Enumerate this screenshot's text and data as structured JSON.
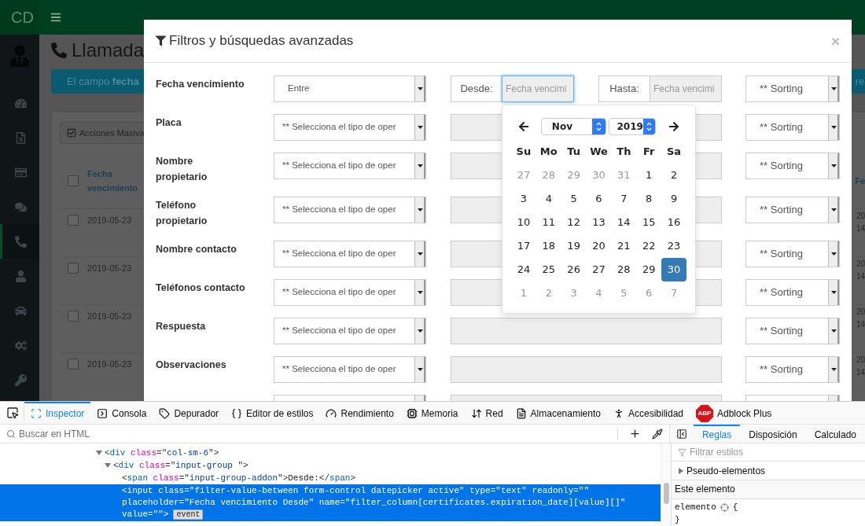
{
  "app": {
    "brand": "CD",
    "page_title": "Llamada",
    "sidebar_items": [
      {
        "selected": false
      },
      {
        "selected": false
      },
      {
        "selected": false
      },
      {
        "selected": false
      },
      {
        "selected": true
      },
      {
        "selected": false
      },
      {
        "selected": false
      },
      {
        "selected": false
      },
      {
        "selected": false
      }
    ],
    "notice": {
      "text": "El campo **fecha**",
      "tail": "re"
    },
    "bulk_button": "Acciones Masiva",
    "table": {
      "header": {
        "checked": false,
        "column_1": "Fecha vencimiento",
        "column_2": "Fe"
      },
      "rows": [
        {
          "checked": false,
          "column_1": "2019-05-23",
          "column_2": [
            "20",
            "14"
          ]
        },
        {
          "checked": false,
          "column_1": "2019-05-23",
          "column_2": [
            "20",
            "14"
          ]
        },
        {
          "checked": false,
          "column_1": "2019-05-23",
          "column_2": [
            "20",
            "14"
          ]
        },
        {
          "checked": false,
          "column_1": "2019-05-23",
          "column_2": [
            "20",
            "14"
          ]
        }
      ]
    }
  },
  "modal": {
    "title": "Filtros y búsquedas avanzadas",
    "close": "×",
    "filters": [
      {
        "kind": "between",
        "label_lines": [
          "Fecha vencimiento"
        ],
        "operator": "Entre",
        "from": {
          "addon": "Desde:",
          "placeholder": "Fecha vencimi",
          "focused": true
        },
        "to": {
          "addon": "Hasta:",
          "placeholder": "Fecha vencimi",
          "focused": false
        },
        "sorting": "** Sorting"
      },
      {
        "kind": "text",
        "label_lines": [
          "Placa"
        ],
        "operator": "** Selecciona el tipo de oper",
        "disabled": true,
        "sorting": "** Sorting"
      },
      {
        "kind": "text",
        "label_lines": [
          "Nombre",
          "propietario"
        ],
        "operator": "** Selecciona el tipo de oper",
        "disabled": true,
        "sorting": "** Sorting"
      },
      {
        "kind": "text",
        "label_lines": [
          "Teléfono",
          "propietario"
        ],
        "operator": "** Selecciona el tipo de oper",
        "disabled": true,
        "sorting": "** Sorting"
      },
      {
        "kind": "text",
        "label_lines": [
          "Nombre contacto"
        ],
        "operator": "** Selecciona el tipo de oper",
        "disabled": true,
        "sorting": "** Sorting"
      },
      {
        "kind": "text",
        "label_lines": [
          "Teléfonos contacto"
        ],
        "operator": "** Selecciona el tipo de oper",
        "disabled": true,
        "sorting": "** Sorting"
      },
      {
        "kind": "text",
        "label_lines": [
          "Respuesta"
        ],
        "operator": "** Selecciona el tipo de oper",
        "disabled": true,
        "sorting": "** Sorting"
      },
      {
        "kind": "text",
        "label_lines": [
          "Observaciones"
        ],
        "operator": "** Selecciona el tipo de oper",
        "disabled": true,
        "sorting": "** Sorting"
      },
      {
        "kind": "text",
        "disabled": true
      }
    ],
    "datepicker": {
      "month": "Nov",
      "year": "2019",
      "weekdays": [
        "Su",
        "Mo",
        "Tu",
        "We",
        "Th",
        "Fr",
        "Sa"
      ],
      "weeks": [
        [
          {
            "day": "27",
            "muted": true,
            "selected": false
          },
          {
            "day": "28",
            "muted": true,
            "selected": false
          },
          {
            "day": "29",
            "muted": true,
            "selected": false
          },
          {
            "day": "30",
            "muted": true,
            "selected": false
          },
          {
            "day": "31",
            "muted": true,
            "selected": false
          },
          {
            "day": "1",
            "muted": false,
            "selected": false
          },
          {
            "day": "2",
            "muted": false,
            "selected": false
          }
        ],
        [
          {
            "day": "3",
            "muted": false,
            "selected": false
          },
          {
            "day": "4",
            "muted": false,
            "selected": false
          },
          {
            "day": "5",
            "muted": false,
            "selected": false
          },
          {
            "day": "6",
            "muted": false,
            "selected": false
          },
          {
            "day": "7",
            "muted": false,
            "selected": false
          },
          {
            "day": "8",
            "muted": false,
            "selected": false
          },
          {
            "day": "9",
            "muted": false,
            "selected": false
          }
        ],
        [
          {
            "day": "10",
            "muted": false,
            "selected": false
          },
          {
            "day": "11",
            "muted": false,
            "selected": false
          },
          {
            "day": "12",
            "muted": false,
            "selected": false
          },
          {
            "day": "13",
            "muted": false,
            "selected": false
          },
          {
            "day": "14",
            "muted": false,
            "selected": false
          },
          {
            "day": "15",
            "muted": false,
            "selected": false
          },
          {
            "day": "16",
            "muted": false,
            "selected": false
          }
        ],
        [
          {
            "day": "17",
            "muted": false,
            "selected": false
          },
          {
            "day": "18",
            "muted": false,
            "selected": false
          },
          {
            "day": "19",
            "muted": false,
            "selected": false
          },
          {
            "day": "20",
            "muted": false,
            "selected": false
          },
          {
            "day": "21",
            "muted": false,
            "selected": false
          },
          {
            "day": "22",
            "muted": false,
            "selected": false
          },
          {
            "day": "23",
            "muted": false,
            "selected": false
          }
        ],
        [
          {
            "day": "24",
            "muted": false,
            "selected": false
          },
          {
            "day": "25",
            "muted": false,
            "selected": false
          },
          {
            "day": "26",
            "muted": false,
            "selected": false
          },
          {
            "day": "27",
            "muted": false,
            "selected": false
          },
          {
            "day": "28",
            "muted": false,
            "selected": false
          },
          {
            "day": "29",
            "muted": false,
            "selected": false
          },
          {
            "day": "30",
            "muted": false,
            "selected": true
          }
        ],
        [
          {
            "day": "1",
            "muted": true,
            "selected": false
          },
          {
            "day": "2",
            "muted": true,
            "selected": false
          },
          {
            "day": "3",
            "muted": true,
            "selected": false
          },
          {
            "day": "4",
            "muted": true,
            "selected": false
          },
          {
            "day": "5",
            "muted": true,
            "selected": false
          },
          {
            "day": "6",
            "muted": true,
            "selected": false
          },
          {
            "day": "7",
            "muted": true,
            "selected": false
          }
        ]
      ]
    }
  },
  "devtools": {
    "tabs": [
      {
        "label": "Inspector",
        "selected": true
      },
      {
        "label": "Consola",
        "selected": false
      },
      {
        "label": "Depurador",
        "selected": false
      },
      {
        "label": "Editor de estilos",
        "selected": false
      },
      {
        "label": "Rendimiento",
        "selected": false
      },
      {
        "label": "Memoria",
        "selected": false
      },
      {
        "label": "Red",
        "selected": false
      },
      {
        "label": "Almacenamiento",
        "selected": false
      },
      {
        "label": "Accesibilidad",
        "selected": false
      },
      {
        "label": "Adblock Plus",
        "selected": false
      }
    ],
    "adblock_badge": "ABP",
    "search_placeholder": "Buscar en HTML",
    "html_tree": [
      {
        "selected": false,
        "expanded": true,
        "tokens": [
          {
            "kind": "punct",
            "t": "<"
          },
          {
            "kind": "tag",
            "t": "div"
          },
          {
            "kind": "attr",
            "t": " class"
          },
          {
            "kind": "punct",
            "t": "=\""
          },
          {
            "kind": "val",
            "t": "col-sm-6"
          },
          {
            "kind": "punct",
            "t": "\">"
          }
        ],
        "children": [
          {
            "selected": false,
            "expanded": true,
            "tokens": [
              {
                "kind": "punct",
                "t": "<"
              },
              {
                "kind": "tag",
                "t": "div"
              },
              {
                "kind": "attr",
                "t": " class"
              },
              {
                "kind": "punct",
                "t": "=\""
              },
              {
                "kind": "val",
                "t": "input-group "
              },
              {
                "kind": "punct",
                "t": "\">"
              }
            ],
            "children": [
              {
                "selected": false,
                "tokens": [
                  {
                    "kind": "punct",
                    "t": "<"
                  },
                  {
                    "kind": "tag",
                    "t": "span"
                  },
                  {
                    "kind": "attr",
                    "t": " class"
                  },
                  {
                    "kind": "punct",
                    "t": "=\""
                  },
                  {
                    "kind": "val",
                    "t": "input-group-addon"
                  },
                  {
                    "kind": "punct",
                    "t": "\">"
                  },
                  {
                    "kind": "text",
                    "t": "Desde:"
                  },
                  {
                    "kind": "punct",
                    "t": "</"
                  },
                  {
                    "kind": "tag",
                    "t": "span"
                  },
                  {
                    "kind": "punct",
                    "t": ">"
                  }
                ]
              },
              {
                "selected": true,
                "lines": [
                  "<input class=\"filter-value-between form-control datepicker active\" type=\"text\" readonly=\"\"",
                  "placeholder=\"Fecha vencimiento Desde\" name=\"filter_column[certificates.expiration_date][value][]\"",
                  "value=\"\">"
                ],
                "badge": "event"
              }
            ]
          }
        ]
      }
    ],
    "side_tabs": [
      {
        "label": "Reglas",
        "selected": true
      },
      {
        "label": "Disposición",
        "selected": false
      },
      {
        "label": "Calculado",
        "selected": false
      }
    ],
    "filter_placeholder": "Filtrar estilos",
    "pseudo_elements": {
      "label": "Pseudo-elementos",
      "expanded": false
    },
    "section_title": "Este elemento",
    "rule": {
      "selector": "elemento",
      "open": "{",
      "close": "}"
    }
  }
}
